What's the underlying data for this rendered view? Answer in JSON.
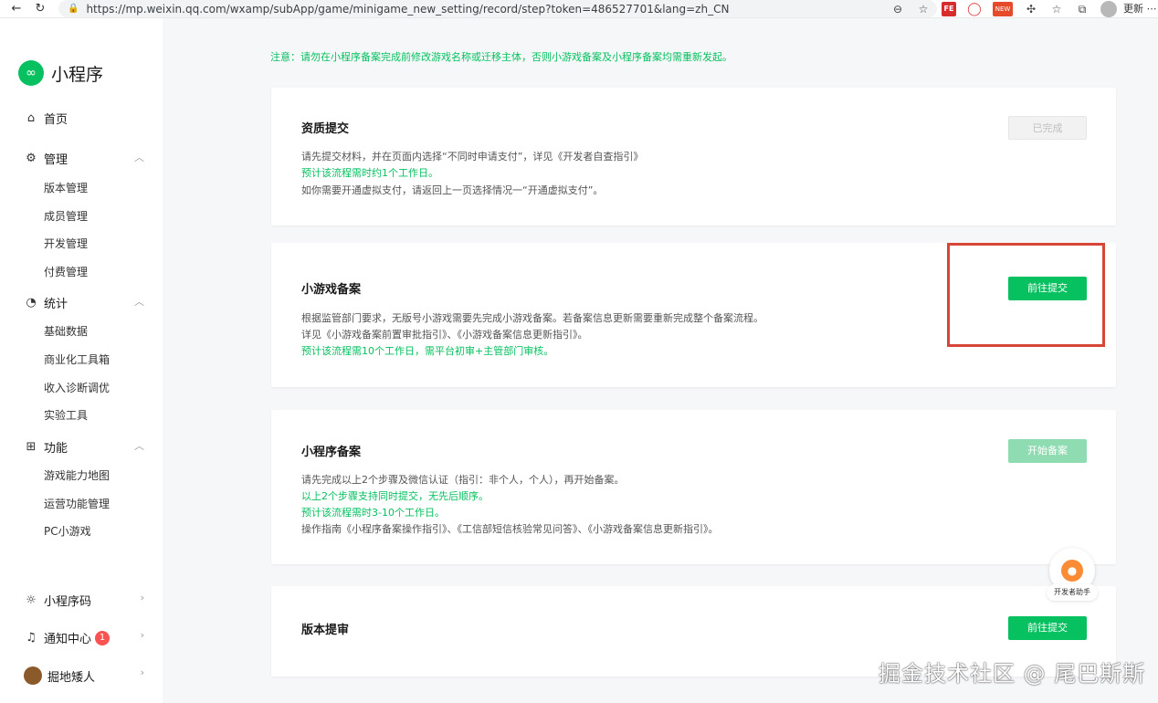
{
  "browser": {
    "url": "https://mp.weixin.qq.com/wxamp/subApp/game/minigame_new_setting/record/step?token=486527701&lang=zh_CN",
    "update_label": "更新 ⋯",
    "ext_fe": "FE",
    "ext_new": "NEW"
  },
  "sidebar": {
    "logo": "小程序",
    "home": "首页",
    "manage": {
      "label": "管理",
      "items": [
        "版本管理",
        "成员管理",
        "开发管理",
        "付费管理"
      ]
    },
    "stats": {
      "label": "统计",
      "items": [
        "基础数据",
        "商业化工具箱",
        "收入诊断调优",
        "实验工具"
      ]
    },
    "features": {
      "label": "功能",
      "items": [
        "游戏能力地图",
        "运营功能管理",
        "PC小游戏"
      ]
    },
    "bottom": {
      "qrcode": "小程序码",
      "notify": "通知中心",
      "notify_count": "1",
      "user": "掘地矮人"
    }
  },
  "notice": "注意：请勿在小程序备案完成前修改游戏名称或迁移主体，否则小游戏备案及小程序备案均需重新发起。",
  "cards": [
    {
      "title": "资质提交",
      "lines": [
        "请先提交材料，并在页面内选择“不同时申请支付”，详见《开发者自查指引》",
        "预计该流程需时约1个工作日。",
        "如你需要开通虚拟支付，请返回上一页选择情况一“开通虚拟支付”。"
      ],
      "button": "已完成"
    },
    {
      "title": "小游戏备案",
      "lines": [
        "根据监管部门要求，无版号小游戏需要先完成小游戏备案。若备案信息更新需要重新完成整个备案流程。",
        "详见《小游戏备案前置审批指引》、《小游戏备案信息更新指引》。",
        "预计该流程需10个工作日，需平台初审+主管部门审核。"
      ],
      "button": "前往提交"
    },
    {
      "title": "小程序备案",
      "lines": [
        "请先完成以上2个步骤及微信认证（指引：非个人，个人），再开始备案。",
        "以上2个步骤支持同时提交，无先后顺序。",
        "预计该流程需时3-10个工作日。",
        "操作指南《小程序备案操作指引》、《工信部短信核验常见问答》、《小游戏备案信息更新指引》。"
      ],
      "button": "开始备案"
    },
    {
      "title": "版本提审",
      "lines": [],
      "button": "前往提交"
    }
  ],
  "helper_label": "开发者助手",
  "watermark": "掘金技术社区 @ 尾巴斯斯"
}
